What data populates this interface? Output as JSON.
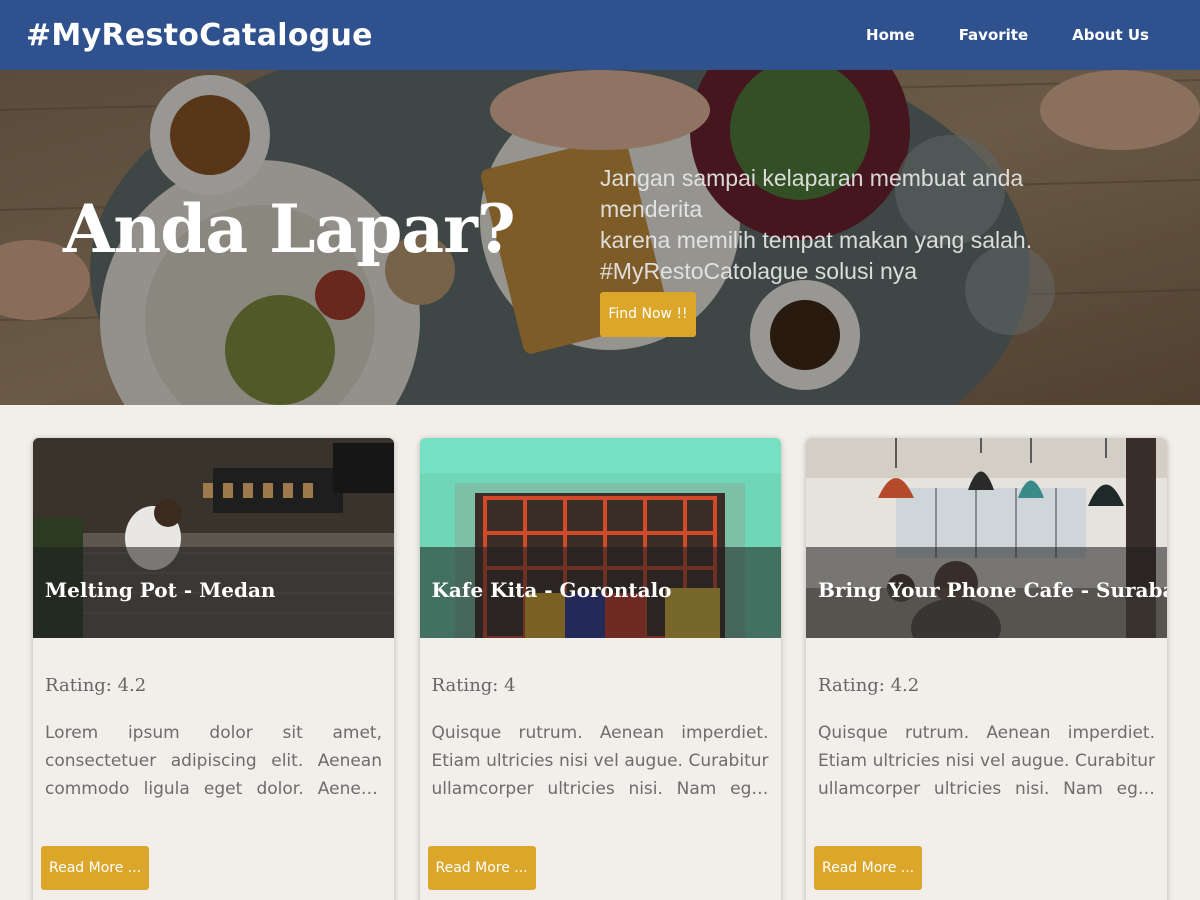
{
  "navbar": {
    "brand": "#MyRestoCatalogue",
    "links": [
      "Home",
      "Favorite",
      "About Us"
    ]
  },
  "hero": {
    "title": "Anda Lapar?",
    "text_line1": "Jangan sampai kelaparan membuat anda menderita",
    "text_line2": "karena memilih tempat makan yang salah.",
    "text_line3": "#MyRestoCatolague solusi nya",
    "button": "Find Now !!"
  },
  "restaurants": [
    {
      "name": "Melting Pot - Medan",
      "rating": "Rating: 4.2",
      "description": "Lorem ipsum dolor sit amet, consectetuer adipiscing elit. Aenean commodo ligula eget dolor. Aenean massa. Cum sociis natoque penatibus et magnis dis parturient montes.",
      "button": "Read More ..."
    },
    {
      "name": "Kafe Kita - Gorontalo",
      "rating": "Rating: 4",
      "description": "Quisque rutrum. Aenean imperdiet. Etiam ultricies nisi vel augue. Curabitur ullamcorper ultricies nisi. Nam eget dui. Etiam rhoncus.",
      "button": "Read More ..."
    },
    {
      "name": "Bring Your Phone Cafe - Surabaya",
      "rating": "Rating: 4.2",
      "description": "Quisque rutrum. Aenean imperdiet. Etiam ultricies nisi vel augue. Curabitur ullamcorper ultricies nisi. Nam eget dui. Etiam rhoncus.",
      "button": "Read More ..."
    }
  ],
  "colors": {
    "navbar": "#2f528f",
    "accent": "#dba629",
    "page_background": "#f2eee9"
  }
}
